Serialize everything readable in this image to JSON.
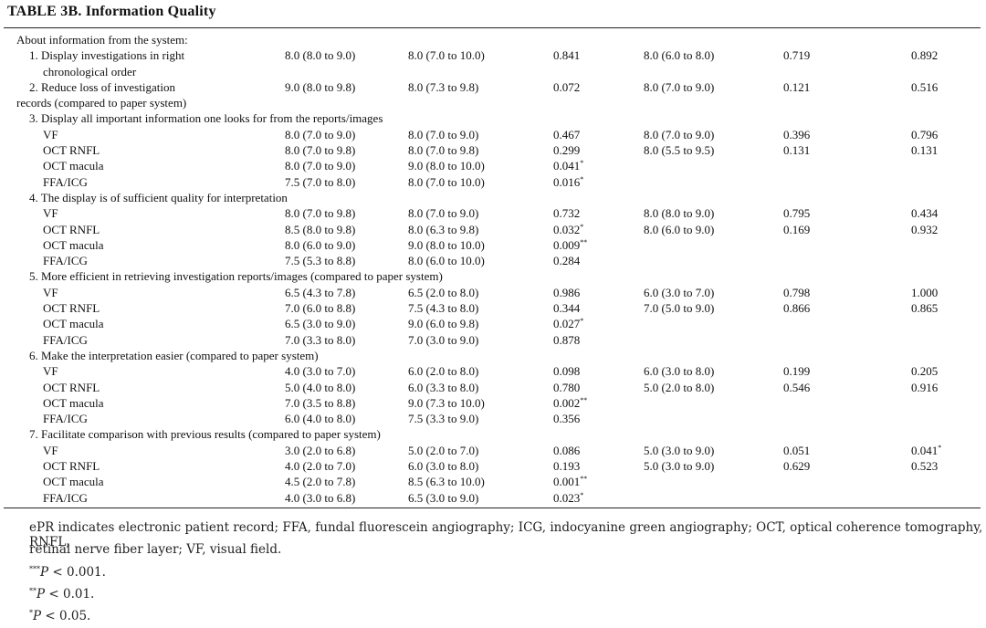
{
  "table": {
    "title": "TABLE 3B. Information Quality",
    "rows": [
      {
        "indent": 0,
        "cells": [
          "About information from the system:",
          "",
          "",
          "",
          "",
          "",
          ""
        ]
      },
      {
        "indent": 1,
        "cells": [
          "1. Display investigations in right",
          "8.0 (8.0 to 9.0)",
          "8.0 (7.0 to 10.0)",
          "0.841",
          "8.0 (6.0 to 8.0)",
          "0.719",
          "0.892"
        ]
      },
      {
        "indent": 2,
        "cells": [
          "chronological order",
          "",
          "",
          "",
          "",
          "",
          ""
        ]
      },
      {
        "indent": 1,
        "cells": [
          "2. Reduce loss of investigation",
          "9.0 (8.0 to 9.8)",
          "8.0 (7.3 to 9.8)",
          "0.072",
          "8.0 (7.0 to 9.0)",
          "0.121",
          "0.516"
        ]
      },
      {
        "indent": 0,
        "cells": [
          "records (compared to paper system)",
          "",
          "",
          "",
          "",
          "",
          ""
        ]
      },
      {
        "indent": 1,
        "cells": [
          "3. Display all important information one looks for from the reports/images",
          "",
          "",
          "",
          "",
          "",
          ""
        ]
      },
      {
        "indent": 2,
        "cells": [
          "VF",
          "8.0 (7.0 to 9.0)",
          "8.0 (7.0 to 9.0)",
          "0.467",
          "8.0 (7.0 to 9.0)",
          "0.396",
          "0.796"
        ]
      },
      {
        "indent": 2,
        "cells": [
          "OCT RNFL",
          "8.0 (7.0 to 9.8)",
          "8.0 (7.0 to 9.8)",
          "0.299",
          "8.0 (5.5 to 9.5)",
          "0.131",
          "0.131"
        ]
      },
      {
        "indent": 2,
        "cells": [
          "OCT macula",
          "8.0 (7.0 to 9.0)",
          "9.0 (8.0 to 10.0)",
          "0.041*",
          "",
          "",
          ""
        ]
      },
      {
        "indent": 2,
        "cells": [
          "FFA/ICG",
          "7.5 (7.0 to 8.0)",
          "8.0 (7.0 to 10.0)",
          "0.016*",
          "",
          "",
          ""
        ]
      },
      {
        "indent": 1,
        "cells": [
          "4. The display is of sufficient quality for interpretation",
          "",
          "",
          "",
          "",
          "",
          ""
        ]
      },
      {
        "indent": 2,
        "cells": [
          "VF",
          "8.0 (7.0 to 9.8)",
          "8.0 (7.0 to 9.0)",
          "0.732",
          "8.0 (8.0 to 9.0)",
          "0.795",
          "0.434"
        ]
      },
      {
        "indent": 2,
        "cells": [
          "OCT RNFL",
          "8.5 (8.0 to 9.8)",
          "8.0 (6.3 to 9.8)",
          "0.032*",
          "8.0 (6.0 to 9.0)",
          "0.169",
          "0.932"
        ]
      },
      {
        "indent": 2,
        "cells": [
          "OCT macula",
          "8.0 (6.0 to 9.0)",
          "9.0 (8.0 to 10.0)",
          "0.009**",
          "",
          "",
          ""
        ]
      },
      {
        "indent": 2,
        "cells": [
          "FFA/ICG",
          "7.5 (5.3 to 8.8)",
          "8.0 (6.0 to 10.0)",
          "0.284",
          "",
          "",
          ""
        ]
      },
      {
        "indent": 1,
        "cells": [
          "5. More efficient in retrieving investigation reports/images (compared to paper system)",
          "",
          "",
          "",
          "",
          "",
          ""
        ]
      },
      {
        "indent": 2,
        "cells": [
          "VF",
          "6.5 (4.3 to 7.8)",
          "6.5 (2.0 to 8.0)",
          "0.986",
          "6.0 (3.0 to 7.0)",
          "0.798",
          "1.000"
        ]
      },
      {
        "indent": 2,
        "cells": [
          "OCT RNFL",
          "7.0 (6.0 to 8.8)",
          "7.5 (4.3 to 8.0)",
          "0.344",
          "7.0 (5.0 to 9.0)",
          "0.866",
          "0.865"
        ]
      },
      {
        "indent": 2,
        "cells": [
          "OCT macula",
          "6.5 (3.0 to 9.0)",
          "9.0 (6.0 to 9.8)",
          "0.027*",
          "",
          "",
          ""
        ]
      },
      {
        "indent": 2,
        "cells": [
          "FFA/ICG",
          "7.0 (3.3 to 8.0)",
          "7.0 (3.0 to 9.0)",
          "0.878",
          "",
          "",
          ""
        ]
      },
      {
        "indent": 1,
        "cells": [
          "6. Make the interpretation easier (compared to paper system)",
          "",
          "",
          "",
          "",
          "",
          ""
        ]
      },
      {
        "indent": 2,
        "cells": [
          "VF",
          "4.0 (3.0 to 7.0)",
          "6.0 (2.0 to 8.0)",
          "0.098",
          "6.0 (3.0 to 8.0)",
          "0.199",
          "0.205"
        ]
      },
      {
        "indent": 2,
        "cells": [
          "OCT RNFL",
          "5.0 (4.0 to 8.0)",
          "6.0 (3.3 to 8.0)",
          "0.780",
          "5.0 (2.0 to 8.0)",
          "0.546",
          "0.916"
        ]
      },
      {
        "indent": 2,
        "cells": [
          "OCT macula",
          "7.0 (3.5 to 8.8)",
          "9.0 (7.3 to 10.0)",
          "0.002**",
          "",
          "",
          ""
        ]
      },
      {
        "indent": 2,
        "cells": [
          "FFA/ICG",
          "6.0 (4.0 to 8.0)",
          "7.5 (3.3 to 9.0)",
          "0.356",
          "",
          "",
          ""
        ]
      },
      {
        "indent": 1,
        "cells": [
          "7. Facilitate comparison with previous results (compared to paper system)",
          "",
          "",
          "",
          "",
          "",
          ""
        ]
      },
      {
        "indent": 2,
        "cells": [
          "VF",
          "3.0 (2.0 to 6.8)",
          "5.0 (2.0 to 7.0)",
          "0.086",
          "5.0 (3.0 to 9.0)",
          "0.051",
          "0.041*"
        ]
      },
      {
        "indent": 2,
        "cells": [
          "OCT RNFL",
          "4.0 (2.0 to 7.0)",
          "6.0 (3.0 to 8.0)",
          "0.193",
          "5.0 (3.0 to 9.0)",
          "0.629",
          "0.523"
        ]
      },
      {
        "indent": 2,
        "cells": [
          "OCT macula",
          "4.5 (2.0 to 7.8)",
          "8.5 (6.3 to 10.0)",
          "0.001**",
          "",
          "",
          ""
        ]
      },
      {
        "indent": 2,
        "cells": [
          "FFA/ICG",
          "4.0 (3.0 to 6.8)",
          "6.5 (3.0 to 9.0)",
          "0.023*",
          "",
          "",
          ""
        ]
      }
    ]
  },
  "footnotes": {
    "line1": "ePR indicates electronic patient record; FFA, fundal fluorescein angiography; ICG, indocyanine green angiography; OCT, optical coherence tomography, RNFL,",
    "line2": "retinal nerve fiber layer; VF, visual field.",
    "sig3_marks": "***",
    "sig3_text": " < 0.001.",
    "sig2_marks": "**",
    "sig2_text": " < 0.01.",
    "sig1_marks": "*",
    "sig1_text": " < 0.05.",
    "p_symbol": "P"
  }
}
